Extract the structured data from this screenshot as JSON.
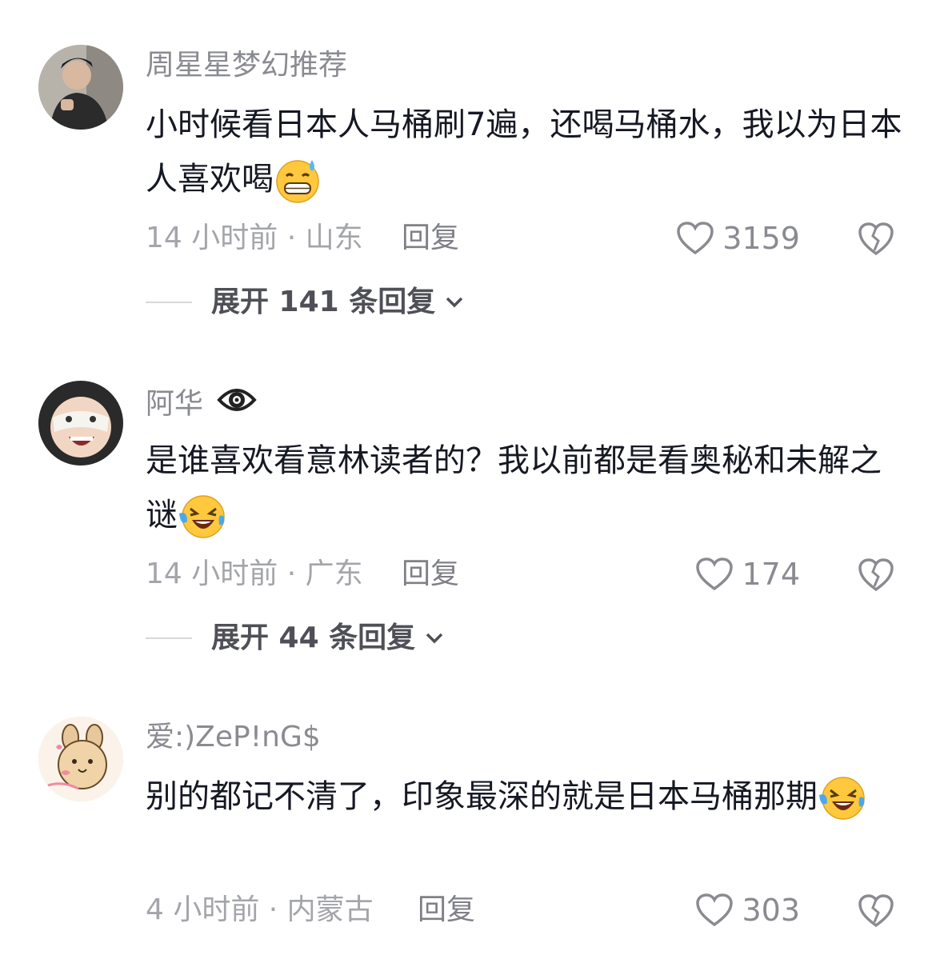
{
  "comments": [
    {
      "username": "周星星梦幻推荐",
      "text": "小时候看日本人马桶刷7遍，还喝马桶水，我以为日本人喜欢喝",
      "time_location": "14 小时前 · 山东",
      "reply_label": "回复",
      "likes": "3159",
      "expand_label": "展开 141 条回复",
      "emoji": "grin-sweat-emoji"
    },
    {
      "username": "阿华",
      "text": "是谁喜欢看意林读者的？我以前都是看奥秘和未解之谜",
      "time_location": "14 小时前 · 广东",
      "reply_label": "回复",
      "likes": "174",
      "expand_label": "展开 44 条回复",
      "emoji": "laugh-cry-emoji"
    },
    {
      "username": "爱:)ZeP!nG$",
      "text": "别的都记不清了，印象最深的就是日本马桶那期",
      "time_location": "4 小时前 · 内蒙古",
      "reply_label": "回复",
      "likes": "303",
      "emoji": "laugh-cry-emoji"
    }
  ],
  "colors": {
    "text": "#161823",
    "username": "#8a8b91",
    "meta": "#a4a5aa"
  }
}
